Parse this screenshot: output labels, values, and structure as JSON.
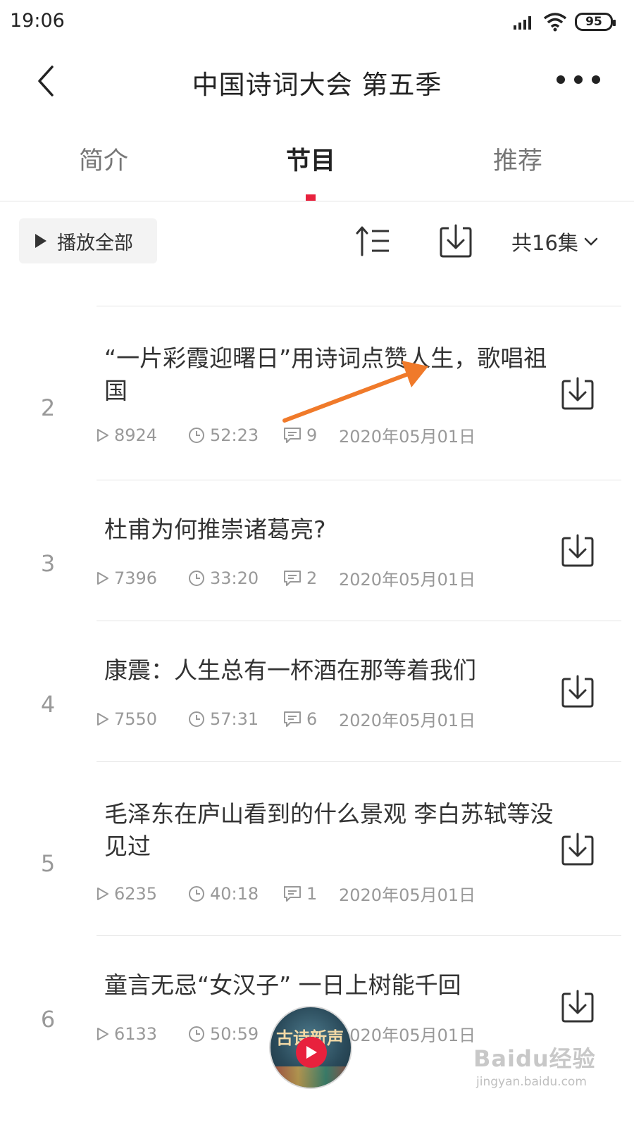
{
  "status_bar": {
    "time": "19:06",
    "battery": "95",
    "icons": [
      "signal-icon",
      "wifi-icon",
      "battery-icon"
    ]
  },
  "nav": {
    "title": "中国诗词大会 第五季",
    "back_icon": "back-icon",
    "more_icon": "more-icon"
  },
  "tabs": [
    {
      "label": "简介",
      "active": false
    },
    {
      "label": "节目",
      "active": true
    },
    {
      "label": "推荐",
      "active": false
    }
  ],
  "toolbar": {
    "play_all_label": "播放全部",
    "sort_icon": "sort-icon",
    "download_icon": "download-icon",
    "episode_count": "共16集"
  },
  "episodes": [
    {
      "num": "2",
      "title": "“一片彩霞迎曙日”用诗词点赞人生，歌唱祖国",
      "plays": "8924",
      "duration": "52:23",
      "comments": "9",
      "date": "2020年05月01日"
    },
    {
      "num": "3",
      "title": "杜甫为何推崇诸葛亮?",
      "plays": "7396",
      "duration": "33:20",
      "comments": "2",
      "date": "2020年05月01日"
    },
    {
      "num": "4",
      "title": "康震：人生总有一杯酒在那等着我们",
      "plays": "7550",
      "duration": "57:31",
      "comments": "6",
      "date": "2020年05月01日"
    },
    {
      "num": "5",
      "title": "毛泽东在庐山看到的什么景观 李白苏轼等没见过",
      "plays": "6235",
      "duration": "40:18",
      "comments": "1",
      "date": "2020年05月01日"
    },
    {
      "num": "6",
      "title": "童言无忌“女汉子” 一日上树能千回",
      "plays": "6133",
      "duration": "50:59",
      "comments": "",
      "date": "2020年05月01日"
    }
  ],
  "mini_player": {
    "cover_text": "古诗新声"
  },
  "watermark": {
    "text": "Baidu经验",
    "sub": "jingyan.baidu.com"
  },
  "colors": {
    "accent": "#e8213d",
    "annotation": "#f07a2a",
    "text_primary": "#333333",
    "text_secondary": "#999999"
  }
}
